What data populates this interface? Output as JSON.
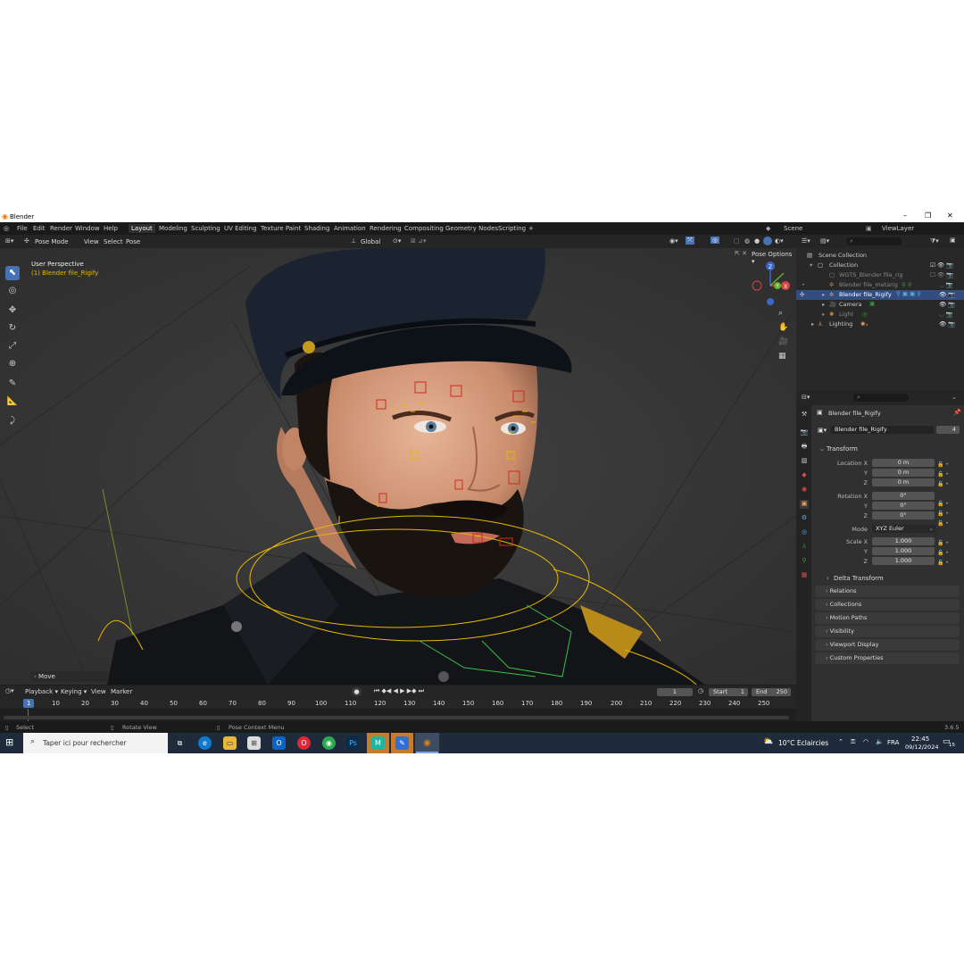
{
  "window": {
    "title": "Blender",
    "icon": "blender-icon",
    "min": "–",
    "max": "❐",
    "close": "✕"
  },
  "menu": {
    "items": [
      "File",
      "Edit",
      "Render",
      "Window",
      "Help"
    ],
    "workspaces": [
      "Layout",
      "Modeling",
      "Sculpting",
      "UV Editing",
      "Texture Paint",
      "Shading",
      "Animation",
      "Rendering",
      "Compositing",
      "Geometry Nodes",
      "Scripting",
      "+"
    ],
    "active_workspace": "Layout",
    "scene": "Scene",
    "view_layer": "ViewLayer"
  },
  "viewport_header": {
    "mode": "Pose Mode",
    "view": "View",
    "select": "Select",
    "pose": "Pose",
    "orientation": "Global",
    "pose_options": "Pose Options"
  },
  "viewport": {
    "perspective": "User Perspective",
    "object": "(1) Blender file_Rigify",
    "operator_panel": "Move",
    "gizmo": {
      "x": "X",
      "y": "Y",
      "z": "Z"
    }
  },
  "outliner": {
    "search_placeholder": "",
    "items": [
      {
        "label": "Scene Collection",
        "icon": "scene-collection-icon"
      },
      {
        "label": "Collection",
        "icon": "collection-icon"
      },
      {
        "label": "WGTS_Blender file_rig",
        "icon": "collection-icon"
      },
      {
        "label": "Blender file_metarig",
        "icon": "armature-icon"
      },
      {
        "label": "Blender file_Rigify",
        "icon": "armature-icon"
      },
      {
        "label": "Camera",
        "icon": "camera-icon"
      },
      {
        "label": "Light",
        "icon": "light-icon"
      },
      {
        "label": "Lighting",
        "icon": "armature-icon"
      }
    ]
  },
  "properties": {
    "object_name": "Blender file_Rigify",
    "data_name": "Blender file_Rigify",
    "users": "4",
    "transform_label": "Transform",
    "location": {
      "label": "Location X",
      "x": "0 m",
      "y": "0 m",
      "z": "0 m"
    },
    "rotation": {
      "label": "Rotation X",
      "x": "0°",
      "y": "0°",
      "z": "0°"
    },
    "mode_label": "Mode",
    "mode_value": "XYZ Euler",
    "scale": {
      "label": "Scale X",
      "x": "1.000",
      "y": "1.000",
      "z": "1.000"
    },
    "axis_y": "Y",
    "axis_z": "Z",
    "delta": "Delta Transform",
    "panels": [
      "Relations",
      "Collections",
      "Motion Paths",
      "Visibility",
      "Viewport Display",
      "Custom Properties"
    ]
  },
  "timeline": {
    "playback": "Playback",
    "keying": "Keying",
    "view": "View",
    "marker": "Marker",
    "current_frame": "1",
    "start_label": "Start",
    "start": "1",
    "end_label": "End",
    "end": "250",
    "ticks": [
      "1",
      "10",
      "20",
      "30",
      "40",
      "50",
      "60",
      "70",
      "80",
      "90",
      "100",
      "110",
      "120",
      "130",
      "140",
      "150",
      "160",
      "170",
      "180",
      "190",
      "200",
      "210",
      "220",
      "230",
      "240",
      "250"
    ]
  },
  "status_bar": {
    "select": "Select",
    "rotate": "Rotate View",
    "context": "Pose Context Menu",
    "version": "3.6.5"
  },
  "taskbar": {
    "search_placeholder": "Taper ici pour rechercher",
    "weather": "10°C  Eclaircies",
    "lang": "FRA",
    "time": "22:45",
    "date": "09/12/2024",
    "notif": "15",
    "apps": [
      "task-view-icon",
      "edge-icon",
      "explorer-icon",
      "store-icon",
      "outlook-icon",
      "opera-icon",
      "chrome-icon",
      "photoshop-icon",
      "m-app-icon",
      "paint-icon",
      "blender-taskbar-icon"
    ]
  },
  "colors": {
    "accent": "#4772b3",
    "selected": "#334d80",
    "bone_red": "#d02a1e",
    "bone_yellow": "#e8b800"
  }
}
